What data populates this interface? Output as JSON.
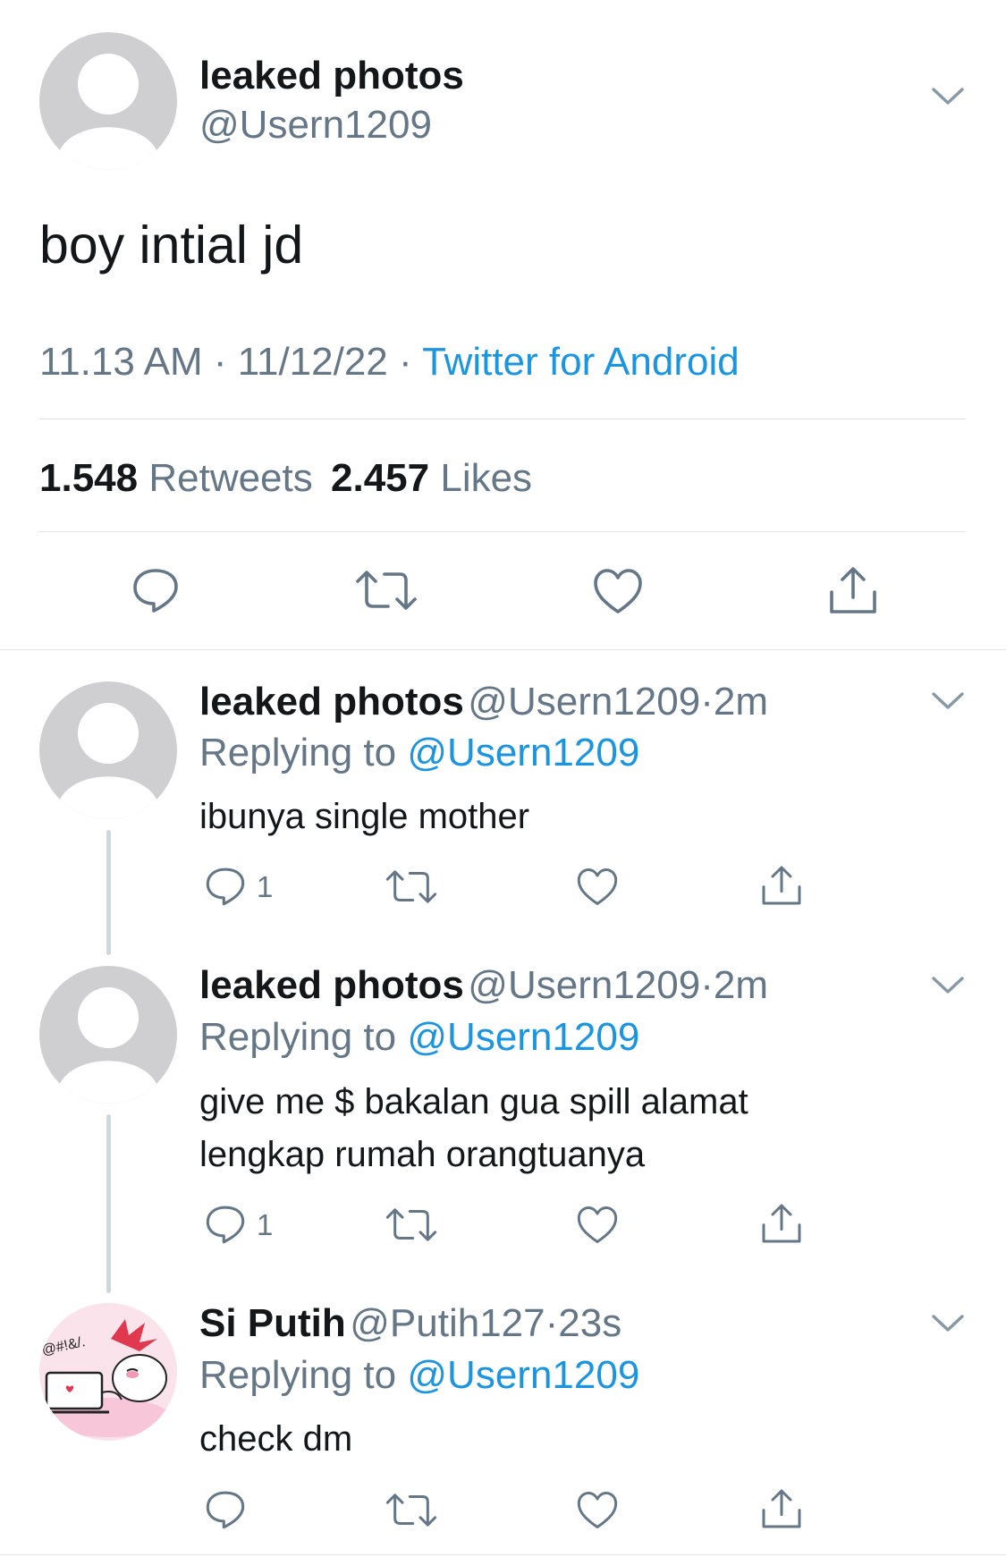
{
  "main_tweet": {
    "name": "leaked photos",
    "handle": "@Usern1209",
    "text": "boy intial jd",
    "time": "11.13 AM",
    "date": "11/12/22",
    "dot": "·",
    "source": "Twitter for Android",
    "retweets_count": "1.548",
    "retweets_label": "Retweets",
    "likes_count": "2.457",
    "likes_label": "Likes"
  },
  "replies": [
    {
      "name": "leaked photos",
      "handle": "@Usern1209",
      "dot": "·",
      "time": "2m",
      "replying_label": "Replying to",
      "replying_to": "@Usern1209",
      "line1": "ibunya single mother",
      "line2": "",
      "reply_count": "1"
    },
    {
      "name": "leaked photos",
      "handle": "@Usern1209",
      "dot": "·",
      "time": "2m",
      "replying_label": "Replying to",
      "replying_to": "@Usern1209",
      "line1": "give me $ bakalan gua spill alamat",
      "line2": "lengkap rumah orangtuanya",
      "reply_count": "1"
    },
    {
      "name": "Si Putih",
      "handle": "@Putih127",
      "dot": "·",
      "time": "23s",
      "replying_label": "Replying to",
      "replying_to": "@Usern1209",
      "line1": "check dm",
      "line2": "",
      "reply_count": "",
      "avatar_text": "@#!&/."
    }
  ],
  "colors": {
    "link": "#1b95e0",
    "muted": "#657786",
    "text": "#14171a",
    "avatar_gray": "#cfcfd1",
    "divider": "#dfe3e6"
  },
  "icons": [
    "chevron-down-icon",
    "reply-icon",
    "retweet-icon",
    "like-icon",
    "share-icon"
  ]
}
